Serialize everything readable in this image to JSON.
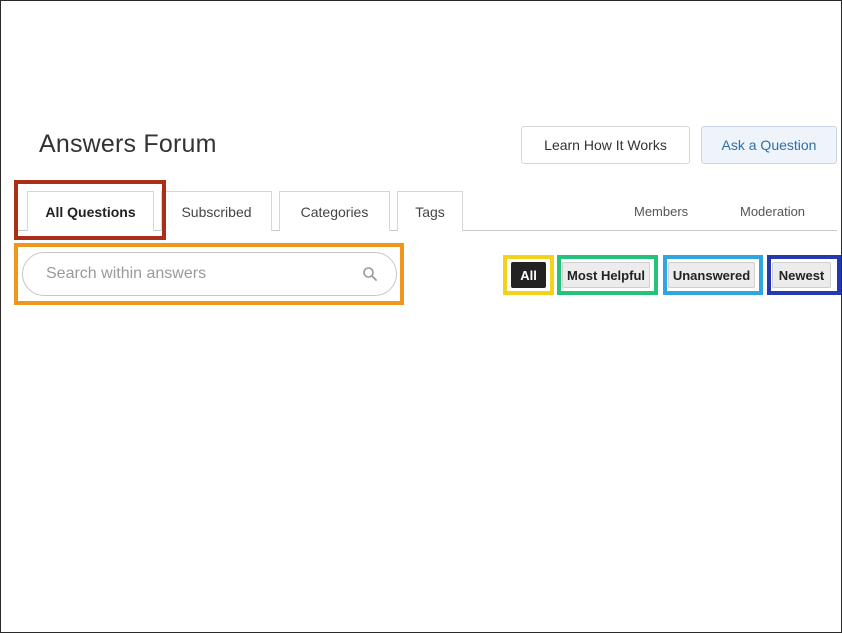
{
  "header": {
    "title": "Answers Forum",
    "learn_label": "Learn How It Works",
    "ask_label": "Ask a Question"
  },
  "tabs": [
    {
      "label": "All Questions",
      "active": true
    },
    {
      "label": "Subscribed",
      "active": false
    },
    {
      "label": "Categories",
      "active": false
    },
    {
      "label": "Tags",
      "active": false
    }
  ],
  "right_links": {
    "members": "Members",
    "moderation": "Moderation"
  },
  "search": {
    "value": "",
    "placeholder": "Search within answers",
    "icon": "search-icon"
  },
  "filters": [
    {
      "label": "All",
      "active": true
    },
    {
      "label": "Most Helpful",
      "active": false
    },
    {
      "label": "Unanswered",
      "active": false
    },
    {
      "label": "Newest",
      "active": false
    }
  ],
  "highlight_colors": {
    "tab_all_questions": "#a92f17",
    "search": "#f0961f",
    "filter_all": "#f2d21b",
    "filter_most_helpful": "#23c47a",
    "filter_unanswered": "#2fa6e0",
    "filter_newest": "#2438b0"
  }
}
